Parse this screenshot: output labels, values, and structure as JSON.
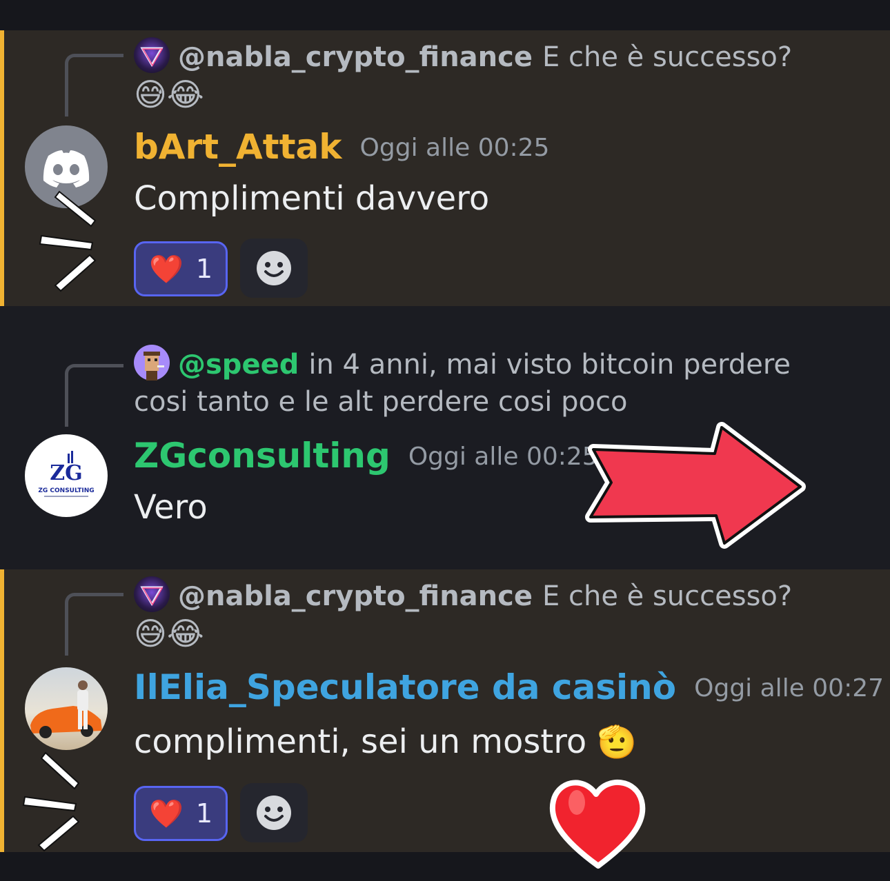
{
  "messages": [
    {
      "reply": {
        "username": "@nabla_crypto_finance",
        "text": "E che è successo?",
        "emojis": "😅😂"
      },
      "author": "bArt_Attak",
      "author_color": "#f0b232",
      "timestamp": "Oggi alle 00:25",
      "content": "Complimenti davvero",
      "reaction": {
        "emoji": "❤️",
        "count": "1"
      },
      "avatar": "discord-default-avatar"
    },
    {
      "reply": {
        "username": "@speed",
        "text": "in 4 anni, mai visto bitcoin perdere cosi tanto e le alt perdere cosi poco"
      },
      "author": "ZGconsulting",
      "author_color": "#2dc770",
      "timestamp": "Oggi alle 00:25",
      "content": "Vero",
      "avatar_text": "ZG CONSULTING"
    },
    {
      "reply": {
        "username": "@nabla_crypto_finance",
        "text": "E che è successo?",
        "emojis": "😅😂"
      },
      "author": "IlElia_Speculatore da casinò",
      "author_color": "#3fa4e0",
      "timestamp": "Oggi alle 00:27",
      "content": "complimenti, sei un mostro",
      "content_emoji": "🫡",
      "reaction": {
        "emoji": "❤️",
        "count": "1"
      },
      "avatar": "car-photo-avatar"
    }
  ],
  "icons": {
    "add_reaction": "smiley-icon",
    "arrow": "red-arrow-sticker",
    "heart": "red-heart-sticker",
    "sparkle": "sparkle-lines-sticker"
  },
  "colors": {
    "mention_bg": "#2d2925",
    "mention_bar": "#f0b232",
    "base_bg": "#1b1c22",
    "reaction_bg": "#3a3c7e",
    "reaction_border": "#5865f2",
    "arrow": "#f0384f"
  }
}
